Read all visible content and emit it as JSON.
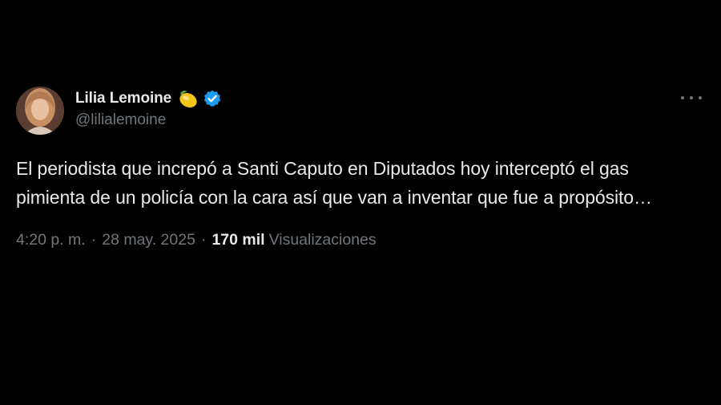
{
  "tweet": {
    "display_name": "Lilia Lemoine",
    "handle": "@lilialemoine",
    "name_emoji": "lemon-emoji",
    "verified_icon": "verified-badge-icon",
    "text": "El periodista que increpó a Santi Caputo en Diputados hoy interceptó el gas pimienta de un policía con la cara así que van a inventar que fue a propósito…",
    "time": "4:20 p. m.",
    "separator": "·",
    "date": "28 may. 2025",
    "views_count": "170 mil",
    "views_label": "Visualizaciones"
  },
  "colors": {
    "background": "#000000",
    "primary_text": "#e7e9ea",
    "secondary_text": "#71767b",
    "verified_blue": "#1d9bf0"
  }
}
